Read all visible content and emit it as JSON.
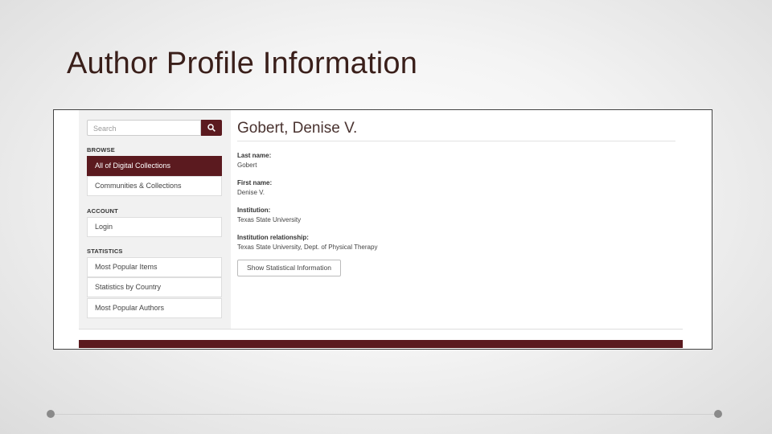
{
  "slide": {
    "title": "Author Profile Information"
  },
  "sidebar": {
    "search_placeholder": "Search",
    "browse_heading": "BROWSE",
    "browse_items": [
      "All of Digital Collections",
      "Communities & Collections"
    ],
    "account_heading": "ACCOUNT",
    "account_items": [
      "Login"
    ],
    "statistics_heading": "STATISTICS",
    "statistics_items": [
      "Most Popular Items",
      "Statistics by Country",
      "Most Popular Authors"
    ]
  },
  "author": {
    "name": "Gobert, Denise V.",
    "fields": [
      {
        "label": "Last name:",
        "value": "Gobert"
      },
      {
        "label": "First name:",
        "value": "Denise V."
      },
      {
        "label": "Institution:",
        "value": "Texas State University"
      },
      {
        "label": "Institution relationship:",
        "value": "Texas State University, Dept. of Physical Therapy"
      }
    ],
    "stats_button": "Show Statistical Information"
  },
  "colors": {
    "accent": "#5b1a1f"
  }
}
